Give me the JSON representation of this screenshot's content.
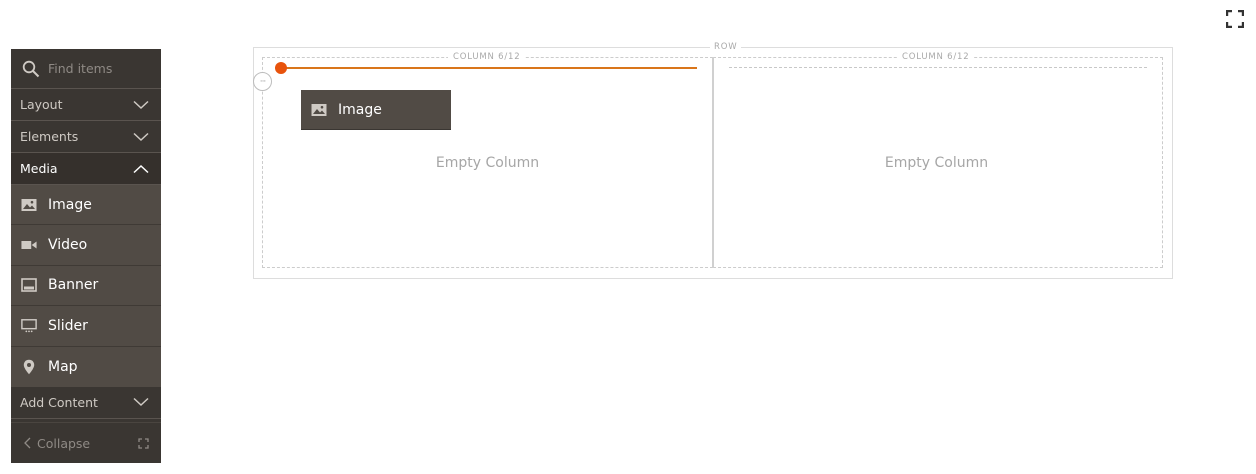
{
  "toolbar": {
    "fullscreen_icon": "fullscreen-icon"
  },
  "sidebar": {
    "search": {
      "icon": "search-icon",
      "placeholder": "Find items",
      "value": ""
    },
    "groups": [
      {
        "label": "Layout",
        "state": "collapsed",
        "icon": "chevron-down-icon"
      },
      {
        "label": "Elements",
        "state": "collapsed",
        "icon": "chevron-down-icon"
      },
      {
        "label": "Media",
        "state": "expanded",
        "icon": "chevron-up-icon"
      }
    ],
    "media_items": [
      {
        "label": "Image",
        "icon": "image-icon"
      },
      {
        "label": "Video",
        "icon": "video-icon"
      },
      {
        "label": "Banner",
        "icon": "banner-icon"
      },
      {
        "label": "Slider",
        "icon": "slider-icon"
      },
      {
        "label": "Map",
        "icon": "map-pin-icon"
      }
    ],
    "add_content": {
      "label": "Add Content",
      "state": "collapsed",
      "icon": "chevron-down-icon"
    },
    "collapse": {
      "label": "Collapse",
      "icon": "chevron-left-icon",
      "expand_icon": "fullscreen-small-icon"
    }
  },
  "stage": {
    "row_label": "ROW",
    "columns": [
      {
        "label": "COLUMN 6/12",
        "empty_text": "Empty Column"
      },
      {
        "label": "COLUMN 6/12",
        "empty_text": "Empty Column"
      }
    ],
    "drag_helper": {
      "label": "Image",
      "icon": "image-icon"
    },
    "resize_handle_icon": "column-resize-handle-icon"
  },
  "colors": {
    "sidebar_bg": "#3a3632",
    "sidebar_item_bg": "#514b45",
    "drop_indicator": "#e8530c",
    "drop_line": "#d9751a"
  }
}
